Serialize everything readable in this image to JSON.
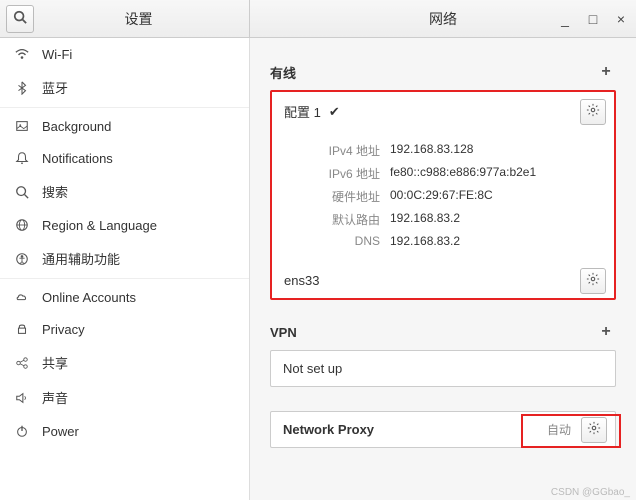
{
  "titlebar": {
    "sidebar_title": "设置",
    "content_title": "网络"
  },
  "sidebar": {
    "items": [
      {
        "icon": "wifi",
        "label": "Wi-Fi"
      },
      {
        "icon": "bluetooth",
        "label": "蓝牙"
      },
      {
        "icon": "background",
        "label": "Background"
      },
      {
        "icon": "bell",
        "label": "Notifications"
      },
      {
        "icon": "search",
        "label": "搜索"
      },
      {
        "icon": "globe",
        "label": "Region & Language"
      },
      {
        "icon": "accessibility",
        "label": "通用辅助功能"
      },
      {
        "icon": "cloud",
        "label": "Online Accounts"
      },
      {
        "icon": "lock",
        "label": "Privacy"
      },
      {
        "icon": "share",
        "label": "共享"
      },
      {
        "icon": "sound",
        "label": "声音"
      },
      {
        "icon": "power",
        "label": "Power"
      }
    ]
  },
  "sections": {
    "wired": {
      "title": "有线",
      "profile": {
        "name": "配置 1",
        "details": [
          {
            "label": "IPv4 地址",
            "value": "192.168.83.128"
          },
          {
            "label": "IPv6 地址",
            "value": "fe80::c988:e886:977a:b2e1"
          },
          {
            "label": "硬件地址",
            "value": "00:0C:29:67:FE:8C"
          },
          {
            "label": "默认路由",
            "value": "192.168.83.2"
          },
          {
            "label": "DNS",
            "value": "192.168.83.2"
          }
        ]
      },
      "interface": "ens33"
    },
    "vpn": {
      "title": "VPN",
      "status": "Not set up"
    },
    "proxy": {
      "title": "Network Proxy",
      "mode": "自动"
    }
  },
  "watermark": "CSDN @GGbao_"
}
